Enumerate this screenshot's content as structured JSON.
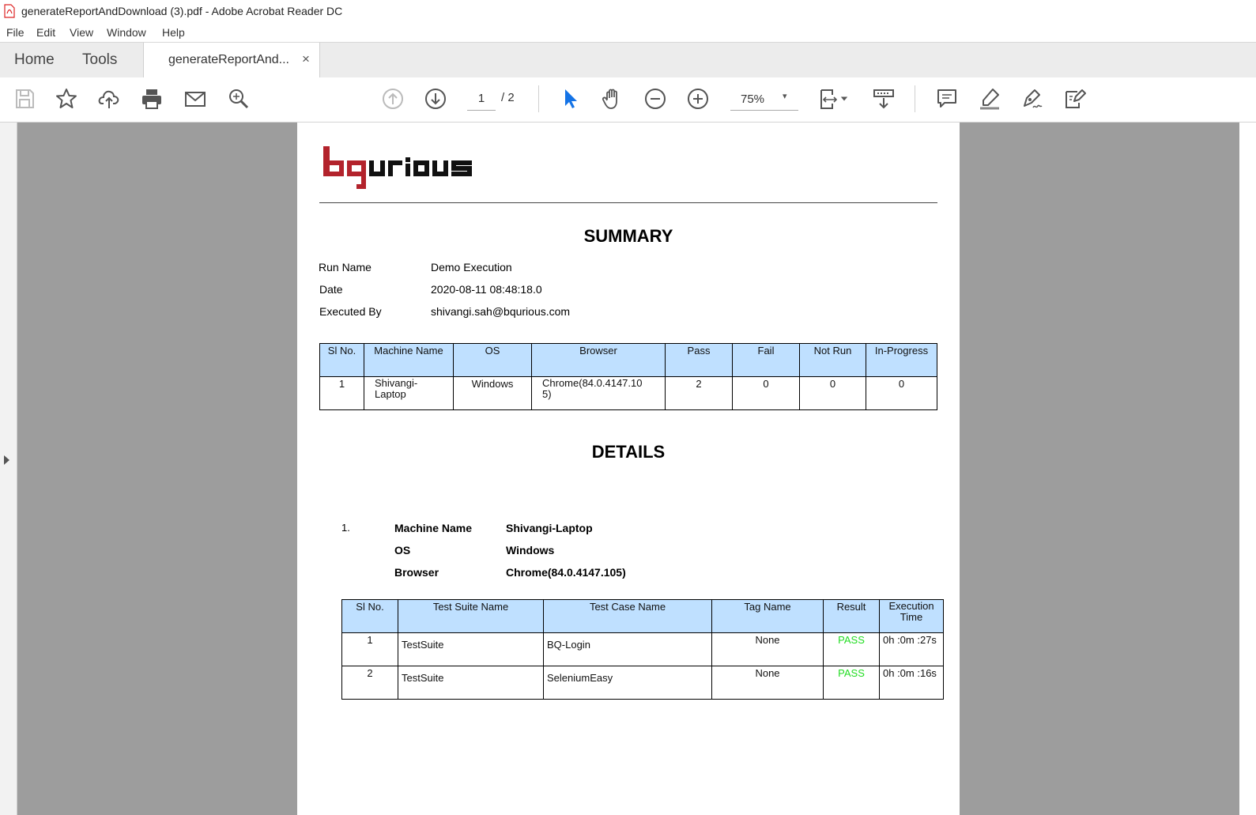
{
  "window": {
    "title": "generateReportAndDownload (3).pdf - Adobe Acrobat Reader DC"
  },
  "menu": [
    "File",
    "Edit",
    "View",
    "Window",
    "Help"
  ],
  "tabs": {
    "home": "Home",
    "tools": "Tools",
    "document": "generateReportAnd...",
    "close": "×"
  },
  "toolbar": {
    "page_current": "1",
    "page_total": "/ 2",
    "zoom": "75%",
    "zoom_caret": "▾"
  },
  "icons": [
    "save-icon",
    "star-icon",
    "upload-cloud-icon",
    "print-icon",
    "mail-icon",
    "search-icon",
    "page-up-icon",
    "page-down-icon",
    "select-cursor-icon",
    "hand-icon",
    "zoom-out-icon",
    "zoom-in-icon",
    "fit-page-icon",
    "scroll-mode-icon",
    "comment-icon",
    "highlight-icon",
    "sign-icon",
    "fill-sign-icon"
  ],
  "report": {
    "summary_heading": "SUMMARY",
    "summary": [
      {
        "label": "Run Name",
        "value": "Demo Execution"
      },
      {
        "label": "Date",
        "value": "2020-08-11 08:48:18.0"
      },
      {
        "label": "Executed By",
        "value": "shivangi.sah@bqurious.com"
      }
    ],
    "summary_table": {
      "headers": [
        "Sl No.",
        "Machine Name",
        "OS",
        "Browser",
        "Pass",
        "Fail",
        "Not Run",
        "In-Progress"
      ],
      "rows": [
        [
          "1",
          "Shivangi-\nLaptop",
          "Windows",
          "Chrome(84.0.4147.10\n5)",
          "2",
          "0",
          "0",
          "0"
        ]
      ]
    },
    "details_heading": "DETAILS",
    "details": {
      "index": "1.",
      "fields": [
        {
          "label": "Machine Name",
          "value": "Shivangi-Laptop"
        },
        {
          "label": "OS",
          "value": "Windows"
        },
        {
          "label": "Browser",
          "value": "Chrome(84.0.4147.105)"
        }
      ]
    },
    "details_table": {
      "headers": [
        "Sl No.",
        "Test Suite Name",
        "Test Case Name",
        "Tag Name",
        "Result",
        "Execution\nTime"
      ],
      "rows": [
        [
          "1",
          "TestSuite",
          "BQ-Login",
          "None",
          "PASS",
          "0h :0m :27s"
        ],
        [
          "2",
          "TestSuite",
          "SeleniumEasy",
          "None",
          "PASS",
          "0h :0m :16s"
        ]
      ]
    }
  },
  "colors": {
    "header_fill": "#bfe0ff",
    "pass": "#22dd22",
    "logo_red": "#b3232c",
    "logo_black": "#111111",
    "accent": "#1473e6"
  }
}
